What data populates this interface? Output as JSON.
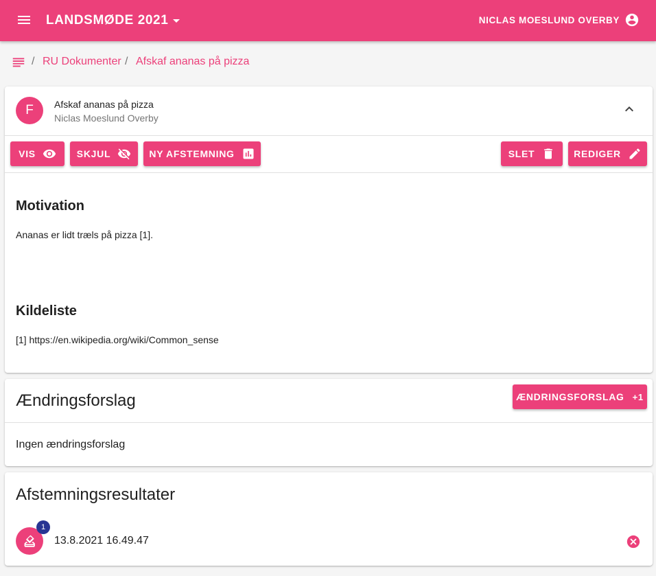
{
  "colors": {
    "primary": "#ec407a",
    "badge": "#283593"
  },
  "appbar": {
    "title": "LANDSMØDE 2021",
    "user_name": "NICLAS MOESLUND OVERBY",
    "icons": {
      "menu": "menu-icon",
      "caret": "arrow-drop-down-icon",
      "user": "account-circle-icon"
    }
  },
  "breadcrumb": {
    "separator": "/",
    "items": [
      "RU Dokumenter",
      "Afskaf ananas på pizza"
    ]
  },
  "document": {
    "avatar_letter": "F",
    "title": "Afskaf ananas på pizza",
    "author": "Niclas Moeslund Overby",
    "buttons": {
      "show": "VIS",
      "hide": "SKJUL",
      "new_vote": "NY AFSTEMNING",
      "delete": "SLET",
      "edit": "REDIGER"
    },
    "motivation_heading": "Motivation",
    "motivation_text": "Ananas er lidt træls på pizza [1].",
    "sources_heading": "Kildeliste",
    "sources_text": "[1] https://en.wikipedia.org/wiki/Common_sense"
  },
  "amendments": {
    "heading": "Ændringsforslag",
    "button_label": "ÆNDRINGSFORSLAG",
    "button_suffix": "+1",
    "empty_text": "Ingen ændringsforslag"
  },
  "results": {
    "heading": "Afstemningsresultater",
    "items": [
      {
        "badge": "1",
        "timestamp": "13.8.2021 16.49.47"
      }
    ]
  }
}
